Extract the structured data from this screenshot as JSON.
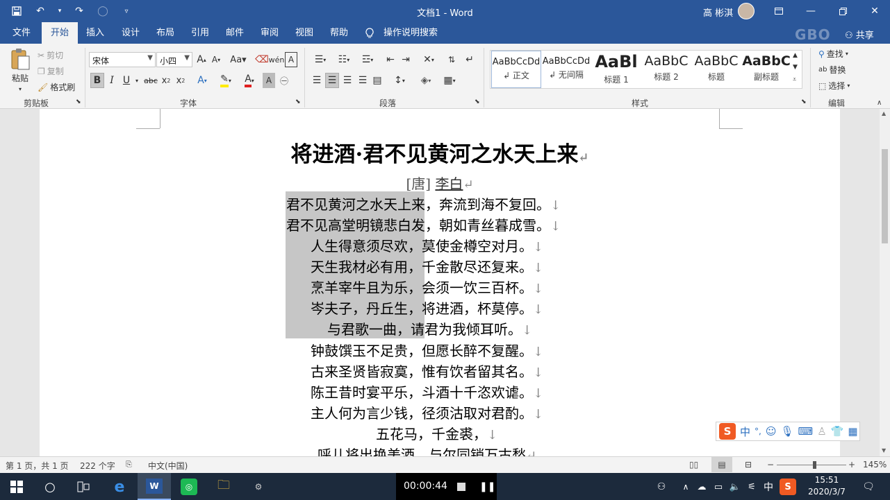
{
  "window": {
    "title": "文档1 - Word",
    "user": "高 彬淇"
  },
  "tabs": [
    "文件",
    "开始",
    "插入",
    "设计",
    "布局",
    "引用",
    "邮件",
    "审阅",
    "视图",
    "帮助"
  ],
  "tell_me": "操作说明搜索",
  "share": "共享",
  "watermark": "GBO",
  "clipboard": {
    "paste": "粘贴",
    "cut": "剪切",
    "copy": "复制",
    "format_painter": "格式刷",
    "label": "剪贴板"
  },
  "font": {
    "family": "宋体",
    "size": "小四",
    "label": "字体",
    "aa_button": "Aa"
  },
  "paragraph": {
    "label": "段落"
  },
  "styles": {
    "label": "样式",
    "items": [
      {
        "sample": "AaBbCcDd",
        "name": "↲ 正文"
      },
      {
        "sample": "AaBbCcDd",
        "name": "↲ 无间隔"
      },
      {
        "sample": "AaBl",
        "name": "标题 1"
      },
      {
        "sample": "AaBbC",
        "name": "标题 2"
      },
      {
        "sample": "AaBbC",
        "name": "标题"
      },
      {
        "sample": "AaBbC",
        "name": "副标题"
      }
    ]
  },
  "editing": {
    "label": "编辑",
    "find": "查找",
    "replace": "替换",
    "select": "选择"
  },
  "document": {
    "title": "将进酒·君不见黄河之水天上来",
    "author_prefix": "[唐]",
    "author": "李白",
    "lines": [
      "君不见黄河之水天上来，奔流到海不复回。",
      "君不见高堂明镜悲白发，朝如青丝暮成雪。",
      "人生得意须尽欢，莫使金樽空对月。",
      "天生我材必有用，千金散尽还复来。",
      "烹羊宰牛且为乐，会须一饮三百杯。",
      "岑夫子，丹丘生，将进酒，杯莫停。",
      "与君歌一曲，请君为我倾耳听。",
      "钟鼓馔玉不足贵，但愿长醉不复醒。",
      "古来圣贤皆寂寞，惟有饮者留其名。",
      "陈王昔时宴平乐，斗酒十千恣欢谑。",
      "主人何为言少钱，径须沽取对君酌。",
      "五花马，千金裘，",
      "呼儿将出换美酒，与尔同销万古愁"
    ],
    "line_mark": "↓",
    "para_mark": "↵"
  },
  "status": {
    "page": "第 1 页，共 1 页",
    "words": "222 个字",
    "language": "中文(中国)",
    "zoom": "145%"
  },
  "ime": {
    "mode": "中",
    "punct": "°,"
  },
  "taskbar": {
    "recorder_time": "00:00:44",
    "time": "15:51",
    "date": "2020/3/7",
    "ime_lang": "中"
  }
}
